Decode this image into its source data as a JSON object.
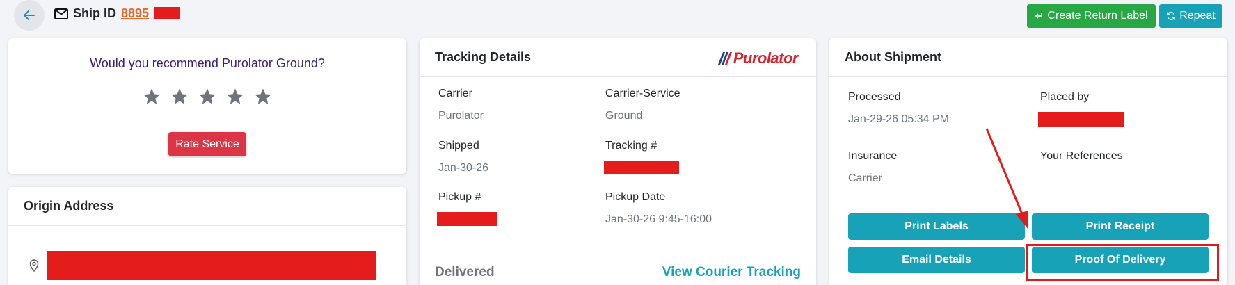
{
  "header": {
    "ship_id_label": "Ship ID",
    "ship_id_number": "8895",
    "create_return_label": "Create Return Label",
    "repeat_label": "Repeat"
  },
  "rating": {
    "question": "Would you recommend Purolator Ground?",
    "stars": 5,
    "rate_button": "Rate Service"
  },
  "origin": {
    "title": "Origin Address"
  },
  "tracking": {
    "title": "Tracking Details",
    "logo_text": "Purolator",
    "carrier_label": "Carrier",
    "carrier_value": "Purolator",
    "service_label": "Carrier-Service",
    "service_value": "Ground",
    "shipped_label": "Shipped",
    "shipped_value": "Jan-30-26",
    "tracking_label": "Tracking #",
    "pickup_num_label": "Pickup #",
    "pickup_date_label": "Pickup Date",
    "pickup_date_value": "Jan-30-26 9:45-16:00",
    "status": "Delivered",
    "courier_link": "View Courier Tracking"
  },
  "about": {
    "title": "About Shipment",
    "processed_label": "Processed",
    "processed_value": "Jan-29-26 05:34 PM",
    "placed_by_label": "Placed by",
    "insurance_label": "Insurance",
    "insurance_value": "Carrier",
    "references_label": "Your References",
    "print_labels": "Print Labels",
    "print_receipt": "Print Receipt",
    "email_details": "Email Details",
    "proof_of_delivery": "Proof Of Delivery"
  },
  "colors": {
    "green": "#28a745",
    "teal": "#17a2b8",
    "red": "#dc3545",
    "orange_link": "#e6692c",
    "annotation_red": "#e01b1b"
  }
}
